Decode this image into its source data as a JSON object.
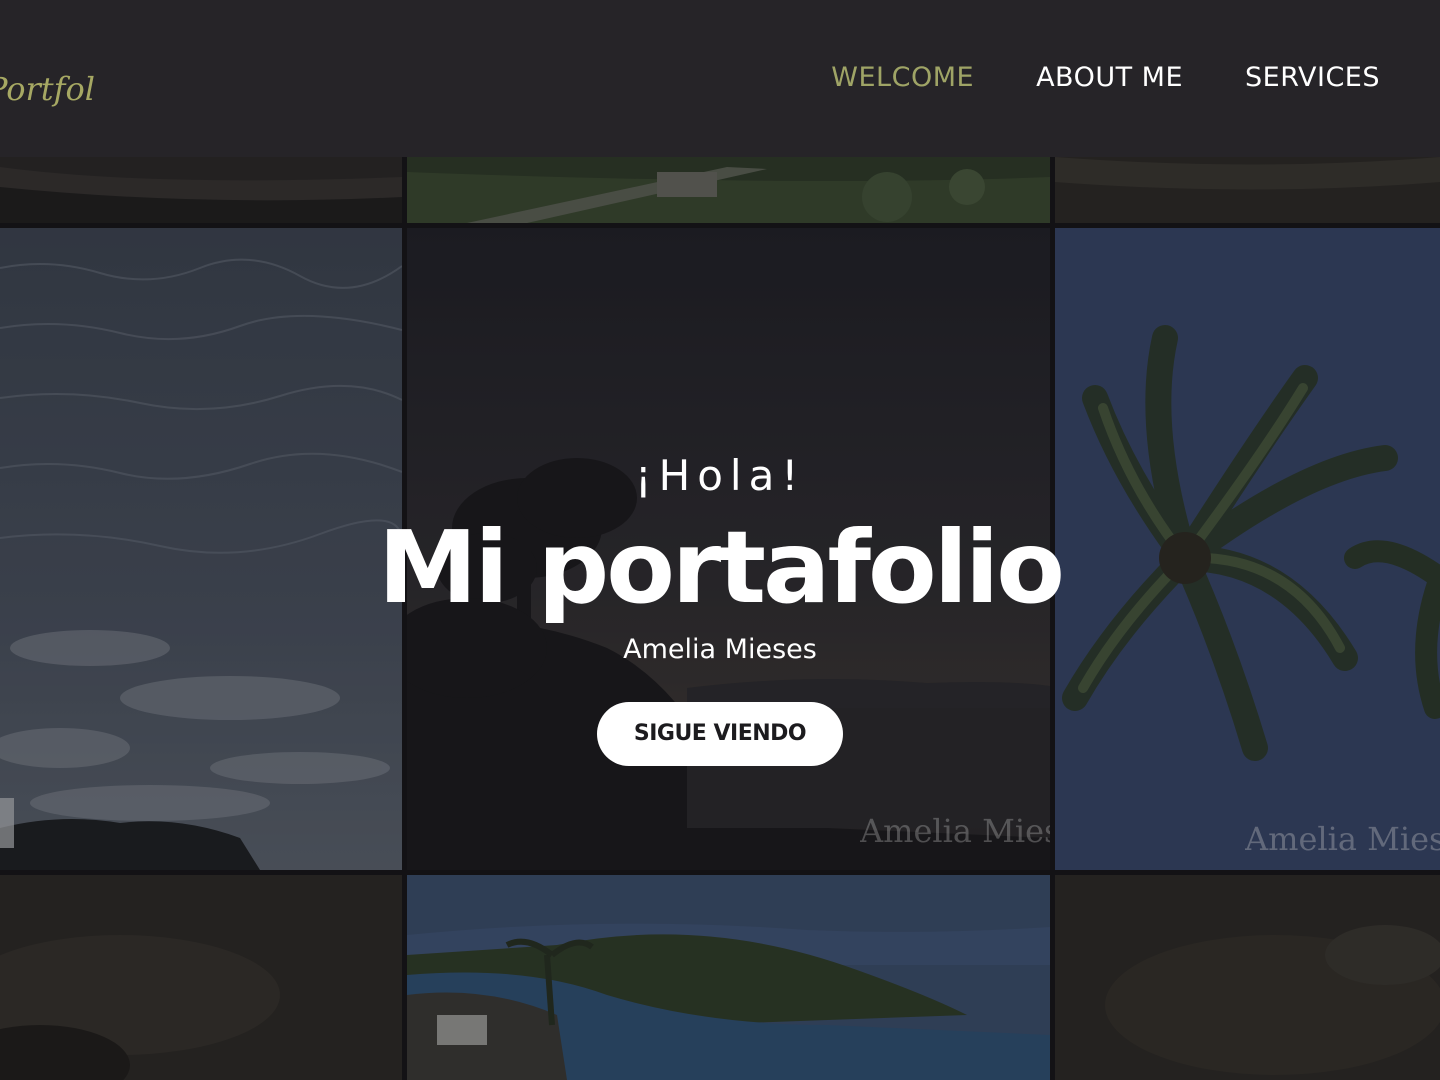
{
  "header": {
    "logo_text": "Portfolio",
    "nav": [
      {
        "label": "WELCOME",
        "active": true
      },
      {
        "label": "ABOUT ME",
        "active": false
      },
      {
        "label": "SERVICES",
        "active": false
      }
    ]
  },
  "hero": {
    "greeting": "¡Hola!",
    "title": "Mi portafolio",
    "subtitle": "Amelia Mieses",
    "cta_label": "SIGUE VIENDO"
  },
  "watermarks": {
    "center": "Amelia  Mieses",
    "right": "Amelia  Mieses"
  },
  "colors": {
    "header_bg": "#262428",
    "accent": "#9fa466",
    "button_bg": "#ffffff",
    "button_text": "#1c1b1e"
  }
}
